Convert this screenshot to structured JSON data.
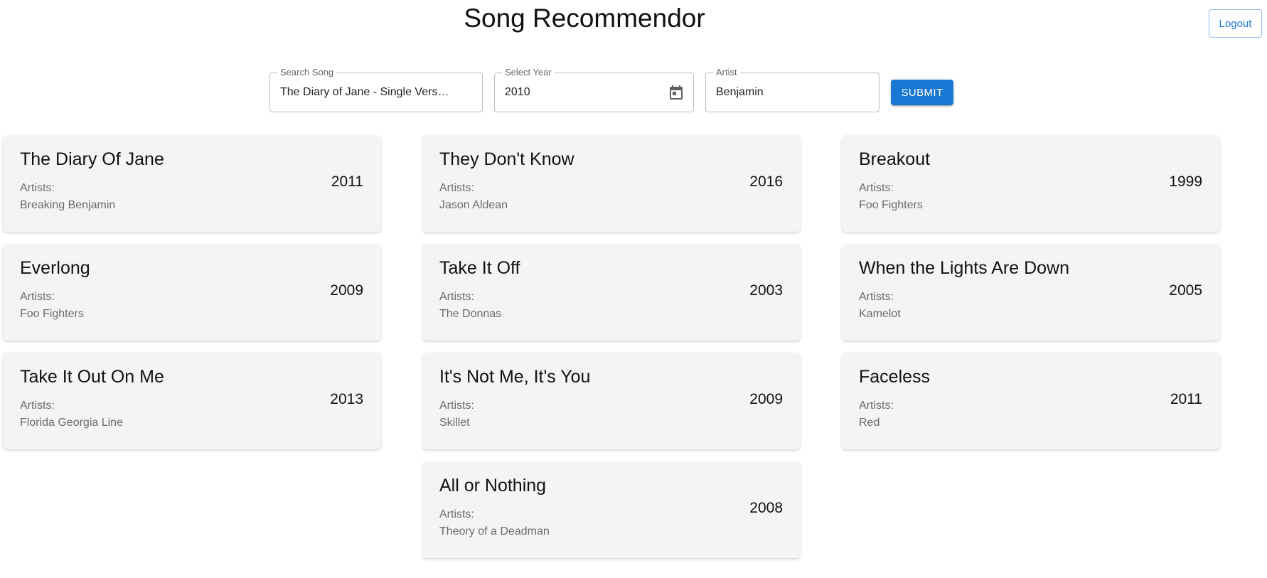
{
  "header": {
    "title": "Song Recommendor",
    "logout_label": "Logout"
  },
  "search": {
    "song_label": "Search Song",
    "song_value": "The Diary of Jane - Single Vers…",
    "year_label": "Select Year",
    "year_value": "2010",
    "artist_label": "Artist",
    "artist_value": "Benjamin",
    "submit_label": "SUBMIT"
  },
  "colors": {
    "accent": "#1976d2",
    "card_background": "#f4f4f4"
  },
  "icons": {
    "year_field": "calendar-icon"
  },
  "results": [
    {
      "title": "The Diary Of Jane",
      "artists_label": "Artists:",
      "artist": "Breaking Benjamin",
      "year": "2011"
    },
    {
      "title": "They Don't Know",
      "artists_label": "Artists:",
      "artist": "Jason Aldean",
      "year": "2016"
    },
    {
      "title": "Breakout",
      "artists_label": "Artists:",
      "artist": "Foo Fighters",
      "year": "1999"
    },
    {
      "title": "Everlong",
      "artists_label": "Artists:",
      "artist": "Foo Fighters",
      "year": "2009"
    },
    {
      "title": "Take It Off",
      "artists_label": "Artists:",
      "artist": "The Donnas",
      "year": "2003"
    },
    {
      "title": "When the Lights Are Down",
      "artists_label": "Artists:",
      "artist": "Kamelot",
      "year": "2005"
    },
    {
      "title": "Take It Out On Me",
      "artists_label": "Artists:",
      "artist": "Florida Georgia Line",
      "year": "2013"
    },
    {
      "title": "It's Not Me, It's You",
      "artists_label": "Artists:",
      "artist": "Skillet",
      "year": "2009"
    },
    {
      "title": "Faceless",
      "artists_label": "Artists:",
      "artist": "Red",
      "year": "2011"
    },
    {
      "title": "All or Nothing",
      "artists_label": "Artists:",
      "artist": "Theory of a Deadman",
      "year": "2008"
    }
  ]
}
